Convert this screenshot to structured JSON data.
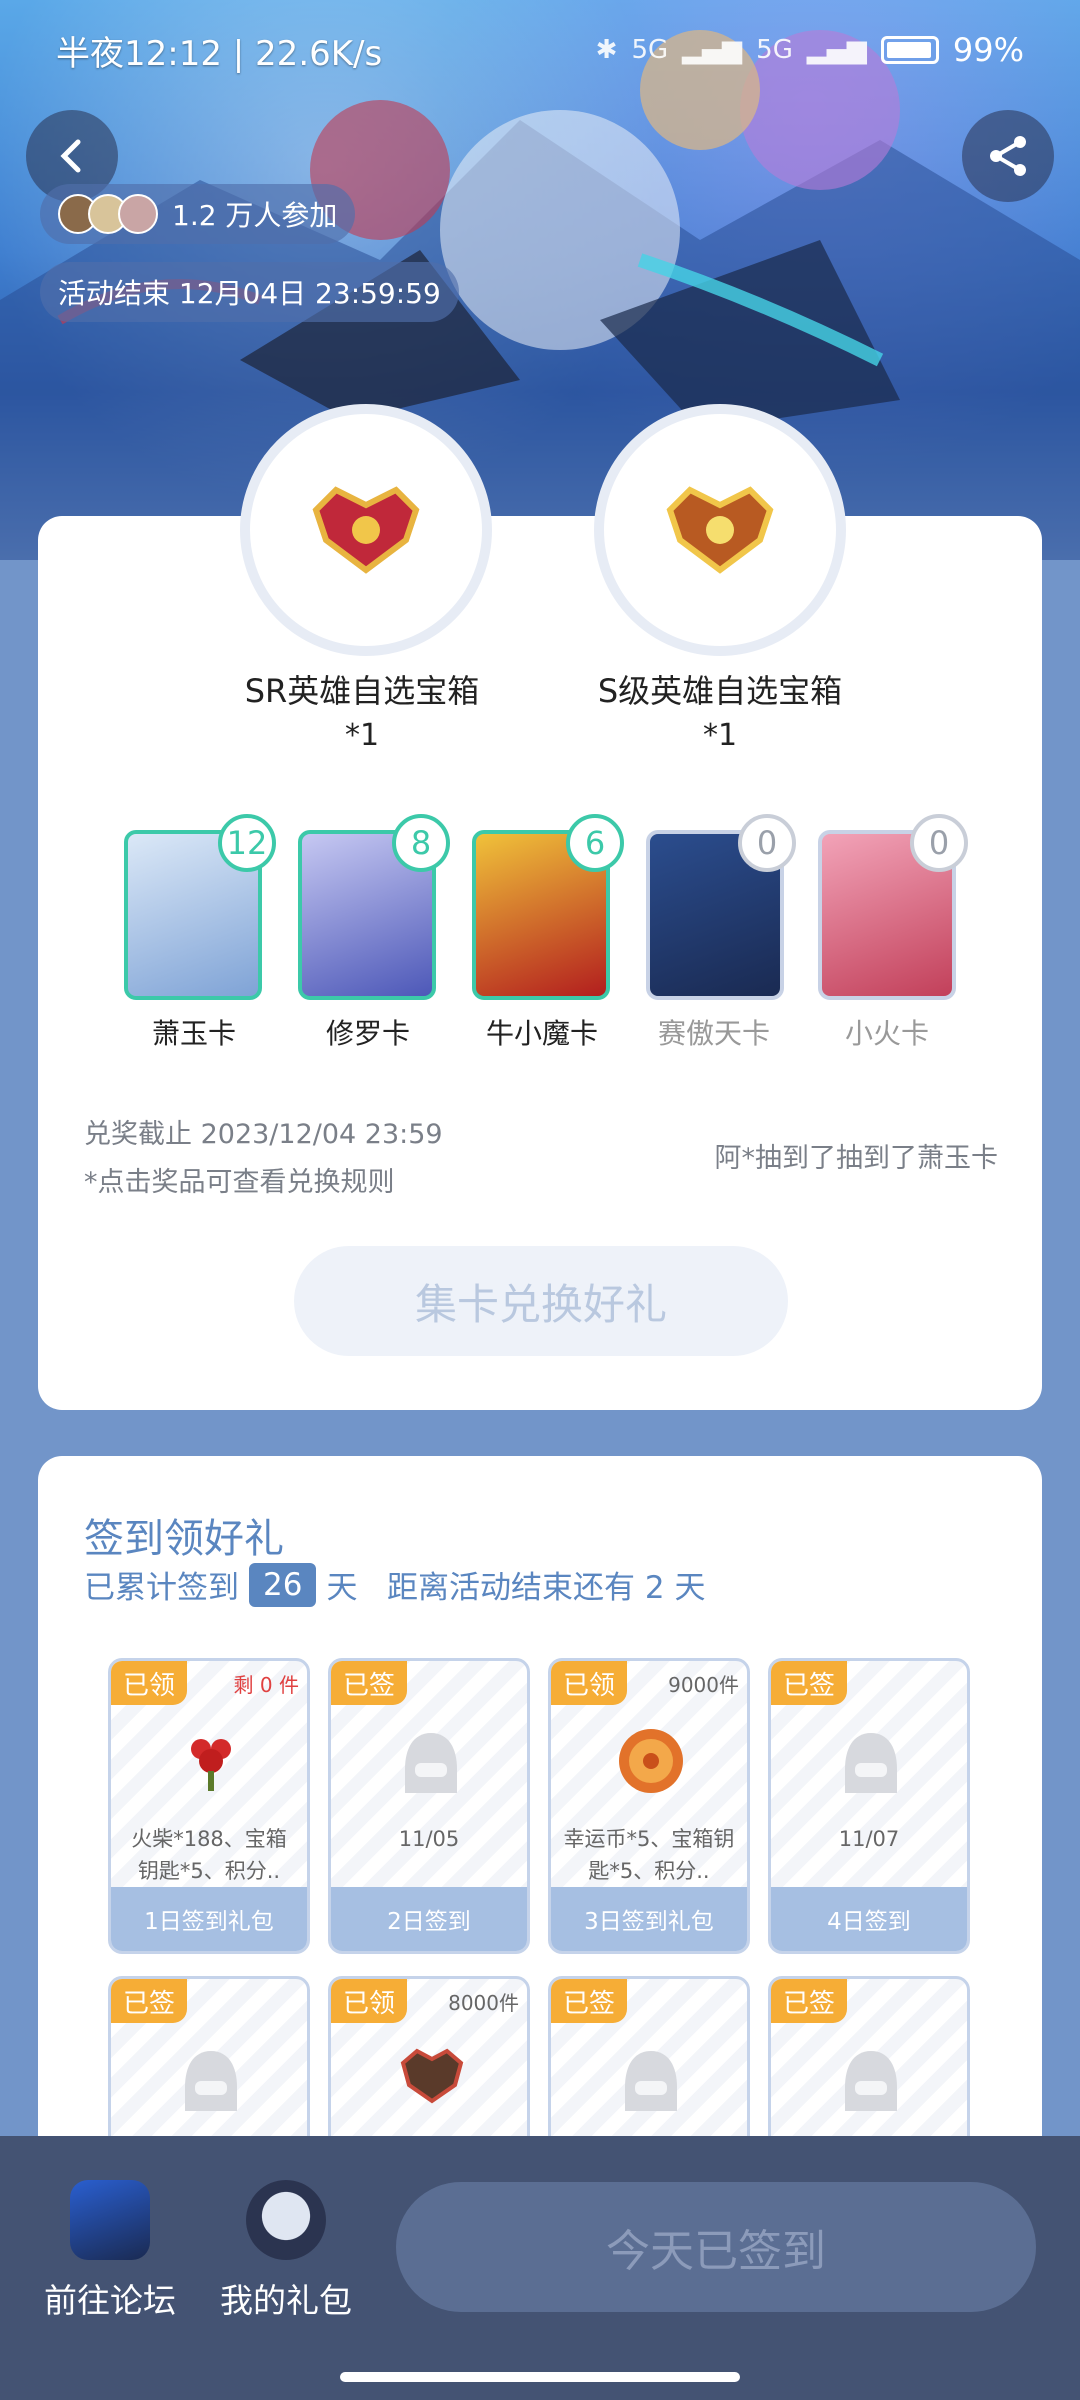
{
  "status_bar": {
    "time_speed": "半夜12:12 | 22.6K/s",
    "network1": "5G",
    "network2": "5G",
    "battery": "99%"
  },
  "header": {
    "participants": "1.2 万人参加",
    "event_end": "活动结束 12月04日 23:59:59"
  },
  "rewards": [
    {
      "name": "SR英雄自选宝箱",
      "qty": "*1"
    },
    {
      "name": "S级英雄自选宝箱",
      "qty": "*1"
    }
  ],
  "hero_cards": [
    {
      "label": "萧玉卡",
      "count": "12"
    },
    {
      "label": "修罗卡",
      "count": "8"
    },
    {
      "label": "牛小魔卡",
      "count": "6"
    },
    {
      "label": "赛傲天卡",
      "count": "0"
    },
    {
      "label": "小火卡",
      "count": "0"
    }
  ],
  "redeem": {
    "deadline": "兑奖截止 2023/12/04 23:59",
    "note": "*点击奖品可查看兑换规则",
    "ticker": "阿*抽到了抽到了萧玉卡",
    "button": "集卡兑换好礼"
  },
  "checkin": {
    "title": "签到领好礼",
    "sub_prefix": "已累计签到",
    "days": "26",
    "sub_suffix": "天   距离活动结束还有 2 天",
    "tiles": [
      {
        "tag": "已领",
        "note": "剩 0 件",
        "desc": "火柴*188、宝箱钥匙*5、积分..",
        "foot": "1日签到礼包"
      },
      {
        "tag": "已签",
        "note": "",
        "desc": "11/05",
        "foot": "2日签到"
      },
      {
        "tag": "已领",
        "note": "9000件",
        "desc": "幸运币*5、宝箱钥匙*5、积分..",
        "foot": "3日签到礼包"
      },
      {
        "tag": "已签",
        "note": "",
        "desc": "11/07",
        "foot": "4日签到"
      },
      {
        "tag": "已签",
        "note": "",
        "desc": "",
        "foot": ""
      },
      {
        "tag": "已领",
        "note": "8000件",
        "desc": "",
        "foot": ""
      },
      {
        "tag": "已签",
        "note": "",
        "desc": "",
        "foot": ""
      },
      {
        "tag": "已签",
        "note": "",
        "desc": "",
        "foot": ""
      }
    ]
  },
  "bottom_bar": {
    "forum": "前往论坛",
    "gifts": "我的礼包",
    "signed_button": "今天已签到"
  }
}
